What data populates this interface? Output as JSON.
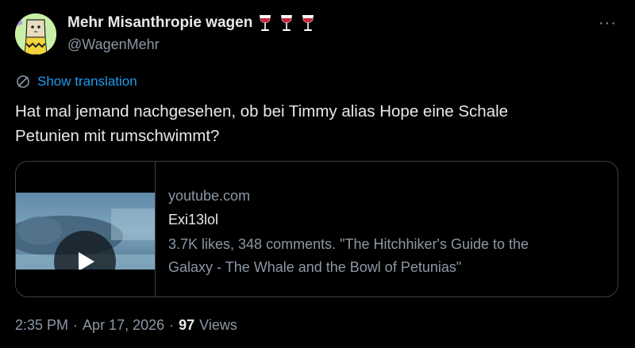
{
  "author": {
    "display_name": "Mehr Misanthropie wagen",
    "handle": "@WagenMehr"
  },
  "more_menu": "···",
  "translation": {
    "label": "Show translation"
  },
  "tweet": {
    "text_line1": "Hat mal jemand nachgesehen, ob bei Timmy alias Hope eine Schale",
    "text_line2": "Petunien mit rumschwimmt?"
  },
  "card": {
    "domain": "youtube.com",
    "title": "Exi13lol",
    "desc_line1": "3.7K likes, 348 comments. \"The Hitchhiker's Guide to the",
    "desc_line2": "Galaxy - The Whale and the Bowl of Petunias\""
  },
  "meta": {
    "time": "2:35 PM",
    "separator": "·",
    "date": "Apr 17, 2026",
    "views_count": "97",
    "views_label": "Views"
  },
  "colors": {
    "background": "#000000",
    "text": "#e7e9ea",
    "secondary": "#8b98a5",
    "link": "#1d9bf0",
    "border": "#3b4147"
  }
}
